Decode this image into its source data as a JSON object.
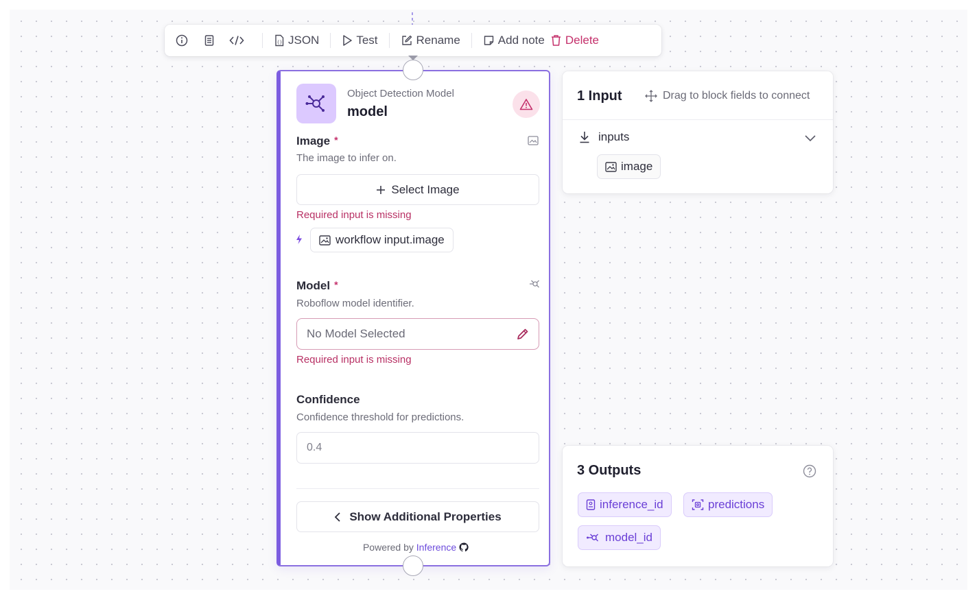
{
  "toolbar": {
    "info_icon": "info-icon",
    "doc_icon": "document-icon",
    "code_icon": "code-icon",
    "json_label": "JSON",
    "test_label": "Test",
    "rename_label": "Rename",
    "add_note_label": "Add note",
    "delete_label": "Delete"
  },
  "node": {
    "subtitle": "Object Detection Model",
    "title": "model",
    "fields": {
      "image": {
        "label": "Image",
        "required_mark": "*",
        "description": "The image to infer on.",
        "select_label": "Select Image",
        "error": "Required input is missing",
        "reference": "workflow input.image"
      },
      "model": {
        "label": "Model",
        "required_mark": "*",
        "description": "Roboflow model identifier.",
        "placeholder": "No Model Selected",
        "error": "Required input is missing"
      },
      "confidence": {
        "label": "Confidence",
        "description": "Confidence threshold for predictions.",
        "value": "0.4"
      }
    },
    "show_more_label": "Show Additional Properties",
    "powered_by": "Powered by",
    "powered_link": "Inference"
  },
  "inputs_panel": {
    "title": "1 Input",
    "hint": "Drag to block fields to connect",
    "group_label": "inputs",
    "items": [
      "image"
    ]
  },
  "outputs_panel": {
    "title": "3 Outputs",
    "items": [
      "inference_id",
      "predictions",
      "model_id"
    ]
  },
  "colors": {
    "accent": "#7c5ce0",
    "danger": "#c4306b",
    "icon_bg": "#dcc9ff",
    "chip_bg": "#f1ebff"
  }
}
